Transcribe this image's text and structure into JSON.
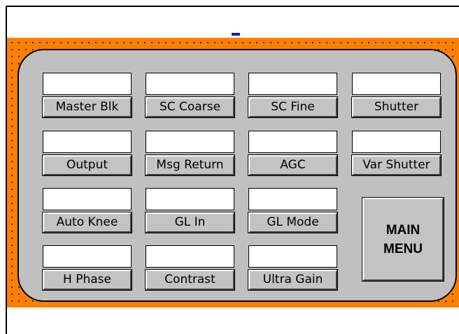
{
  "controls": [
    {
      "label": "Master Blk",
      "value": ""
    },
    {
      "label": "SC Coarse",
      "value": ""
    },
    {
      "label": "SC Fine",
      "value": ""
    },
    {
      "label": "Shutter",
      "value": ""
    },
    {
      "label": "Output",
      "value": ""
    },
    {
      "label": "Msg Return",
      "value": ""
    },
    {
      "label": "AGC",
      "value": ""
    },
    {
      "label": "Var Shutter",
      "value": ""
    },
    {
      "label": "Auto Knee",
      "value": ""
    },
    {
      "label": "GL In",
      "value": ""
    },
    {
      "label": "GL Mode",
      "value": ""
    },
    {
      "label": "H Phase",
      "value": ""
    },
    {
      "label": "Contrast",
      "value": ""
    },
    {
      "label": "Ultra Gain",
      "value": ""
    }
  ],
  "main_menu": {
    "line1": "MAIN",
    "line2": "MENU"
  },
  "colors": {
    "background": "#ff7f00",
    "panel": "#c0c0c0"
  }
}
